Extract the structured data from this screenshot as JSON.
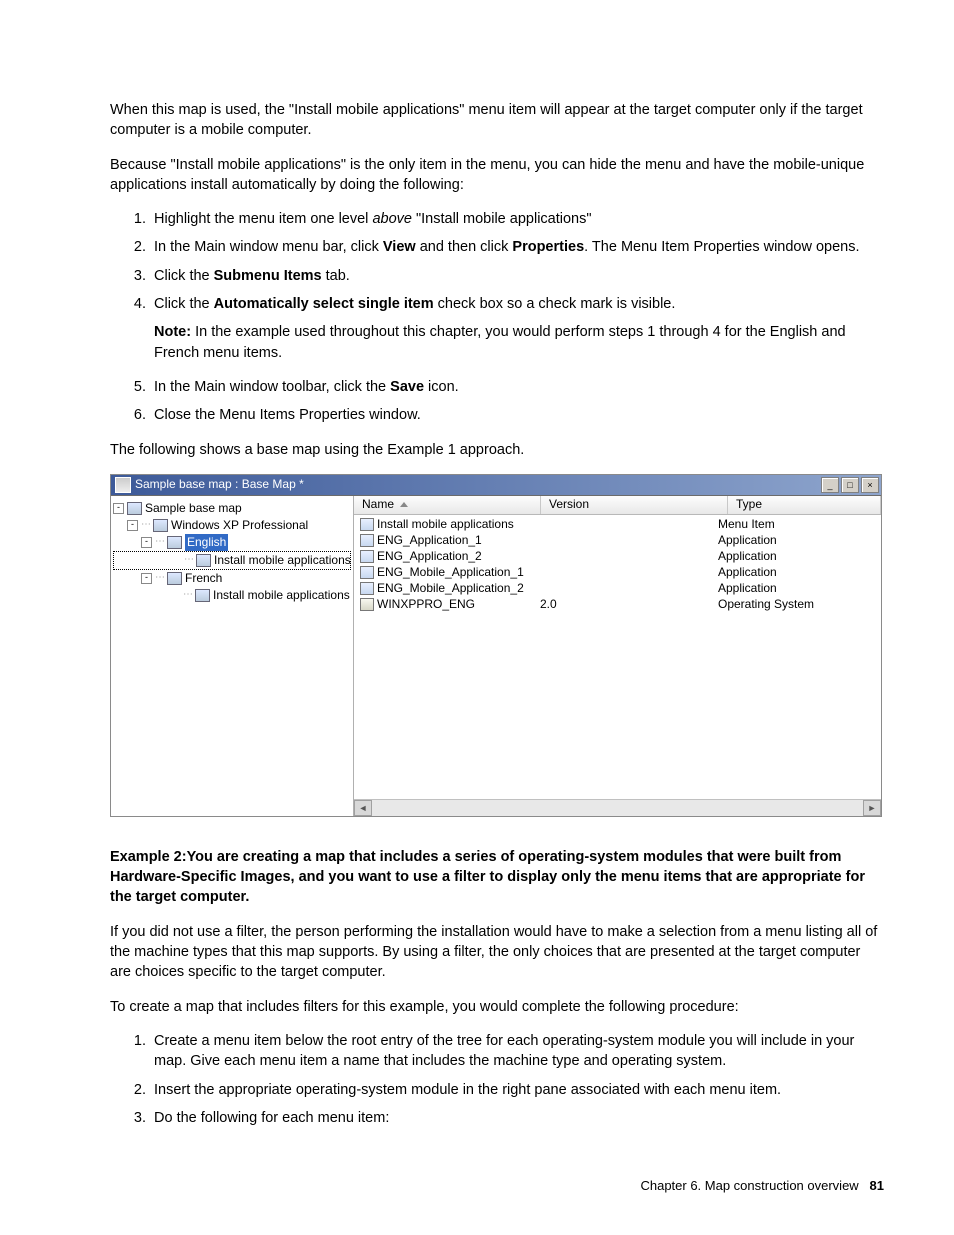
{
  "para1": "When this map is used, the \"Install mobile applications\" menu item will appear at the target computer only if the target computer is a mobile computer.",
  "para2": "Because \"Install mobile applications\" is the only item in the menu, you can hide the menu and have the mobile-unique applications install automatically by doing the following:",
  "ol1": {
    "i1a": "Highlight the menu item one level ",
    "i1b": "above",
    "i1c": " \"Install mobile applications\"",
    "i2a": "In the Main window menu bar, click ",
    "i2b": "View",
    "i2c": " and then click ",
    "i2d": "Properties",
    "i2e": ". The Menu Item Properties window opens.",
    "i3a": "Click the ",
    "i3b": "Submenu Items",
    "i3c": " tab.",
    "i4a": "Click the ",
    "i4b": "Automatically select single item",
    "i4c": " check box so a check mark is visible.",
    "noteA": "Note:",
    "noteB": " In the example used throughout this chapter, you would perform steps 1 through 4 for the English and French menu items.",
    "i5a": "In the Main window toolbar, click the ",
    "i5b": "Save",
    "i5c": " icon.",
    "i6": "Close the Menu Items Properties window."
  },
  "para3": "The following shows a base map using the Example 1 approach.",
  "win": {
    "title": "Sample base map : Base Map *",
    "tree": {
      "n1": "Sample base map",
      "n2": "Windows XP Professional",
      "n3": "English",
      "n4": "Install mobile applications",
      "n5": "French",
      "n6": "Install mobile applications"
    },
    "cols": {
      "name": "Name",
      "version": "Version",
      "type": "Type"
    },
    "rows": [
      {
        "name": "Install mobile applications",
        "ver": "",
        "type": "Menu Item",
        "os": false
      },
      {
        "name": "ENG_Application_1",
        "ver": "",
        "type": "Application",
        "os": false
      },
      {
        "name": "ENG_Application_2",
        "ver": "",
        "type": "Application",
        "os": false
      },
      {
        "name": "ENG_Mobile_Application_1",
        "ver": "",
        "type": "Application",
        "os": false
      },
      {
        "name": "ENG_Mobile_Application_2",
        "ver": "",
        "type": "Application",
        "os": false
      },
      {
        "name": "WINXPPRO_ENG",
        "ver": "2.0",
        "type": "Operating System",
        "os": true
      }
    ]
  },
  "ex2head": "Example 2:You are creating a map that includes a series of operating-system modules that were built from Hardware-Specific Images, and you want to use a filter to display only the menu items that are appropriate for the target computer.",
  "para4": "If you did not use a filter, the person performing the installation would have to make a selection from a menu listing all of the machine types that this map supports. By using a filter, the only choices that are presented at the target computer are choices specific to the target computer.",
  "para5": "To create a map that includes filters for this example, you would complete the following procedure:",
  "ol2": {
    "i1": "Create a menu item below the root entry of the tree for each operating-system module you will include in your map. Give each menu item a name that includes the machine type and operating system.",
    "i2": "Insert the appropriate operating-system module in the right pane associated with each menu item.",
    "i3": "Do the following for each menu item:"
  },
  "footer": {
    "chapter": "Chapter 6. Map construction overview",
    "page": "81"
  }
}
